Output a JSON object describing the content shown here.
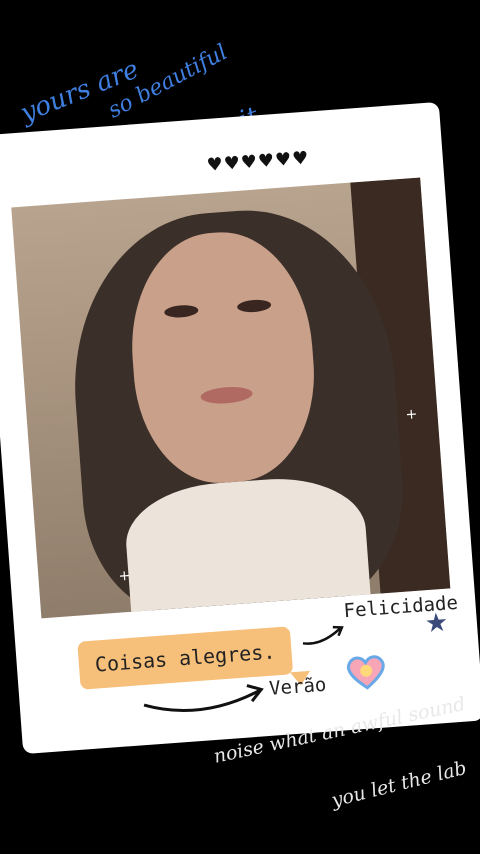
{
  "scribbles_top": {
    "line1": "yours are",
    "line2": "so beautiful",
    "line3": "Do you know it"
  },
  "polaroid": {
    "hearts": "♥♥♥♥♥♥",
    "tag_text": "Coisas alegres.",
    "label_felicidade": "Felicidade",
    "label_verao": "Verão"
  },
  "scribbles_bottom": {
    "line1": "noise what an awful sound",
    "line2": "you let the lab"
  },
  "colors": {
    "scribble_blue": "#3f7fe0",
    "tag_bg": "#f6bf7a",
    "star": "#3a4a7a"
  },
  "icons": [
    "heart-icon",
    "star-icon",
    "arrow-icon",
    "sparkle-icon"
  ]
}
